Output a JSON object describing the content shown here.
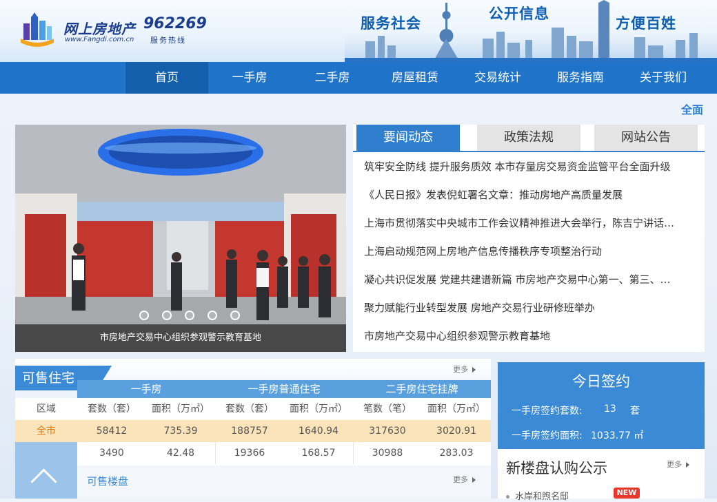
{
  "header": {
    "logo_text": "网上房地产",
    "logo_url": "www.Fangdi.com.cn",
    "hotline": "962269",
    "hotline_sub": "服务热线",
    "slogans": [
      "服务社会",
      "公开信息",
      "方便百姓"
    ]
  },
  "nav": {
    "items": [
      "首页",
      "一手房",
      "二手房",
      "房屋租赁",
      "交易统计",
      "服务指南",
      "关于我们"
    ],
    "active_index": 0
  },
  "top_right_text": "全面",
  "slider": {
    "caption": "市房地产交易中心组织参观警示教育基地",
    "dot_count": 5,
    "active_dot": 0
  },
  "news": {
    "tabs": [
      "要闻动态",
      "政策法规",
      "网站公告"
    ],
    "active_tab": 0,
    "items": [
      "筑牢安全防线 提升服务质效 本市存量房交易资金监管平台全面升级",
      "《人民日报》发表倪虹署名文章：推动房地产高质量发展",
      "上海市贯彻落实中央城市工作会议精神推进大会举行，陈吉宁讲话…",
      "上海启动规范网上房地产信息传播秩序专项整治行动",
      "凝心共识促发展 党建共建谱新篇 市房地产交易中心第一、第三、…",
      "聚力赋能行业转型发展 房地产交易行业研修班举办",
      "市房地产交易中心组织参观警示教育基地"
    ]
  },
  "stats": {
    "title": "可售住宅",
    "more_label": "更多",
    "groups": [
      "一手房",
      "一手房普通住宅",
      "二手房住宅挂牌"
    ],
    "columns": [
      "区域",
      "套数（套）",
      "面积（万㎡）",
      "套数（套）",
      "面积（万㎡）",
      "笔数（笔）",
      "面积（万㎡）"
    ],
    "rows": [
      [
        "全市",
        "58412",
        "735.39",
        "188757",
        "1640.94",
        "317630",
        "3020.91"
      ],
      [
        "",
        "3490",
        "42.48",
        "19366",
        "168.57",
        "30988",
        "283.03"
      ]
    ],
    "sale_projects_label": "可售楼盘",
    "sale_more_label": "更多"
  },
  "sign": {
    "title": "今日签约",
    "count_label": "一手房签约套数:",
    "count_value": "13",
    "count_unit": "套",
    "area_label": "一手房签约面积:",
    "area_value": "1033.77 ㎡"
  },
  "new_projects": {
    "title": "新楼盘认购公示",
    "more_label": "更多",
    "first_item": "水岸和煦名邸",
    "badge": "NEW"
  },
  "colors": {
    "nav_bg": "#1f73c8",
    "nav_active": "#145fac",
    "accent": "#3a8ad6",
    "highlight_row": "#fbe3ba",
    "badge_red": "#e8382b"
  }
}
